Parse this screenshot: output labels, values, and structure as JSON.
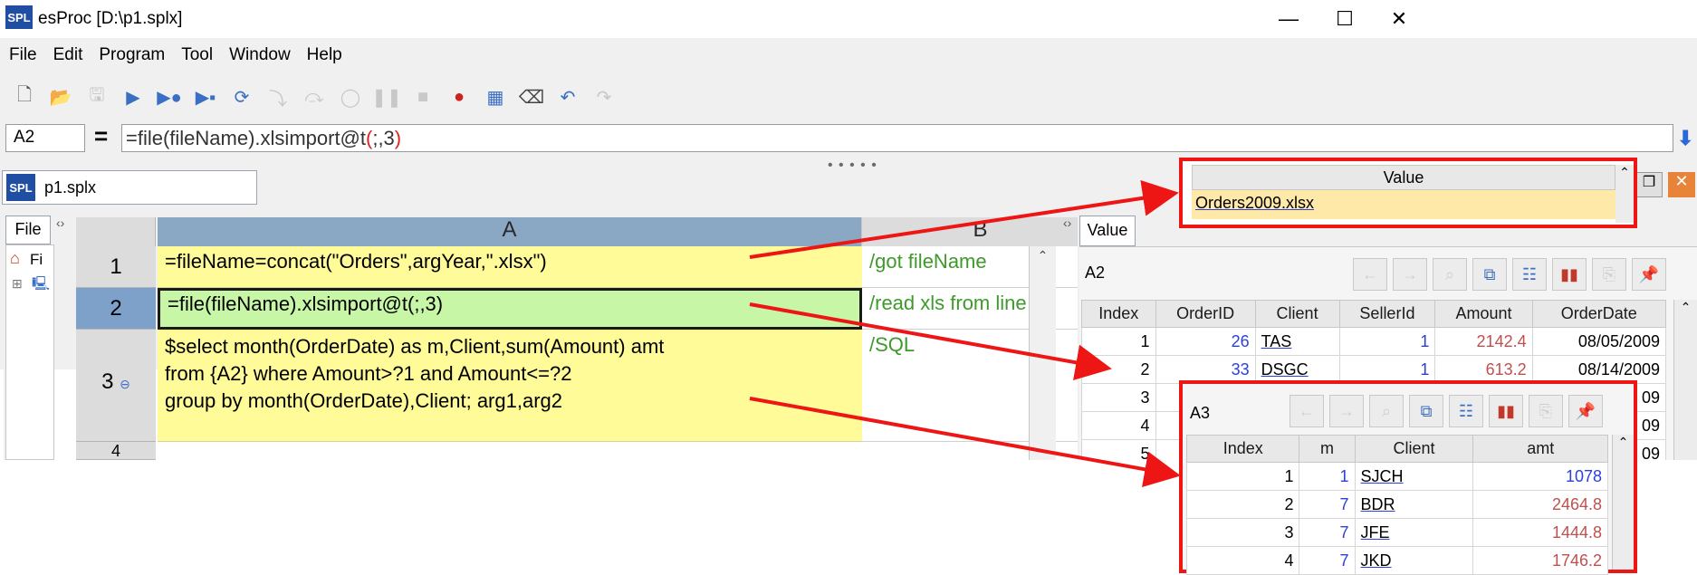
{
  "window": {
    "title": "esProc  [D:\\p1.splx]",
    "logo": "SPL",
    "minimize": "—",
    "maximize": "☐",
    "close": "✕"
  },
  "menu": [
    "File",
    "Edit",
    "Program",
    "Tool",
    "Window",
    "Help"
  ],
  "formula_bar": {
    "cell_ref": "A2",
    "equals": "=",
    "formula_pre": "=file(fileName).xlsimport@t",
    "formula_hl1": "(",
    "formula_mid": ";,3",
    "formula_hl2": ")"
  },
  "tab": {
    "file_name": "p1.splx",
    "logo": "SPL"
  },
  "left_panel": {
    "tab": "File",
    "tree_label": "Fi"
  },
  "grid": {
    "col_a": "A",
    "col_b": "B",
    "rows": [
      {
        "num": "1",
        "a": "=fileName=concat(\"Orders\",argYear,\".xlsx\")",
        "b": "/got fileName"
      },
      {
        "num": "2",
        "a": "=file(fileName).xlsimport@t(;,3)",
        "b": "/read xls from line 3"
      },
      {
        "num": "3",
        "a_lines": [
          "$select month(OrderDate) as m,Client,sum(Amount) amt",
          "from {A2} where Amount>?1 and Amount<=?2",
          "group by month(OrderDate),Client; arg1,arg2"
        ],
        "b": "/SQL"
      },
      {
        "num": "4"
      }
    ]
  },
  "value_panel": {
    "tab": "Value",
    "cell": "A2",
    "columns": [
      "Index",
      "OrderID",
      "Client",
      "SellerId",
      "Amount",
      "OrderDate"
    ],
    "rows": [
      [
        "1",
        "26",
        "TAS",
        "1",
        "2142.4",
        "08/05/2009"
      ],
      [
        "2",
        "33",
        "DSGC",
        "1",
        "613.2",
        "08/14/2009"
      ],
      [
        "3",
        "",
        "",
        "",
        "",
        "09"
      ],
      [
        "4",
        "",
        "",
        "",
        "",
        "09"
      ],
      [
        "5",
        "",
        "",
        "",
        "",
        "09"
      ]
    ]
  },
  "value_popup": {
    "header": "Value",
    "value": "Orders2009.xlsx"
  },
  "a3_popup": {
    "cell": "A3",
    "columns": [
      "Index",
      "m",
      "Client",
      "amt"
    ],
    "rows": [
      [
        "1",
        "1",
        "SJCH",
        "1078"
      ],
      [
        "2",
        "7",
        "BDR",
        "2464.8"
      ],
      [
        "3",
        "7",
        "JFE",
        "1444.8"
      ],
      [
        "4",
        "7",
        "JKD",
        "1746.2"
      ]
    ]
  },
  "colors": {
    "callout": "#ee1515",
    "cell_yellow": "#fffb98",
    "cell_green": "#c7f7a6",
    "comment_green": "#3e9a2a",
    "header_blue": "#8aa7c4"
  }
}
